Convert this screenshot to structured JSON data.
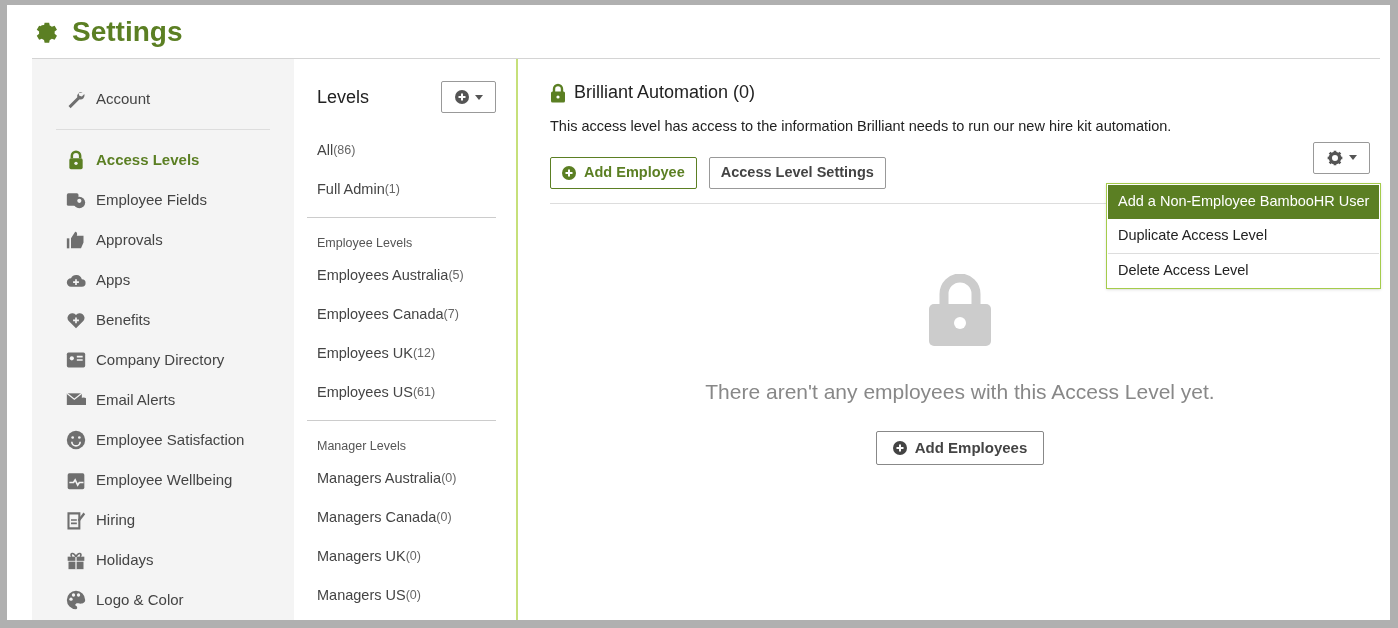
{
  "page_title": "Settings",
  "sidebar": {
    "items": [
      {
        "label": "Account",
        "selected": false
      },
      {
        "label": "Access Levels",
        "selected": true
      },
      {
        "label": "Employee Fields",
        "selected": false
      },
      {
        "label": "Approvals",
        "selected": false
      },
      {
        "label": "Apps",
        "selected": false
      },
      {
        "label": "Benefits",
        "selected": false
      },
      {
        "label": "Company Directory",
        "selected": false
      },
      {
        "label": "Email Alerts",
        "selected": false
      },
      {
        "label": "Employee Satisfaction",
        "selected": false
      },
      {
        "label": "Employee Wellbeing",
        "selected": false
      },
      {
        "label": "Hiring",
        "selected": false
      },
      {
        "label": "Holidays",
        "selected": false
      },
      {
        "label": "Logo & Color",
        "selected": false
      }
    ]
  },
  "levels": {
    "title": "Levels",
    "groups": [
      {
        "items": [
          {
            "name": "All",
            "count": "(86)"
          },
          {
            "name": "Full Admin",
            "count": "(1)"
          }
        ]
      },
      {
        "heading": "Employee Levels",
        "items": [
          {
            "name": "Employees Australia",
            "count": "(5)"
          },
          {
            "name": "Employees Canada",
            "count": "(7)"
          },
          {
            "name": "Employees UK",
            "count": "(12)"
          },
          {
            "name": "Employees US",
            "count": "(61)"
          }
        ]
      },
      {
        "heading": "Manager Levels",
        "items": [
          {
            "name": "Managers Australia",
            "count": "(0)"
          },
          {
            "name": "Managers Canada",
            "count": "(0)"
          },
          {
            "name": "Managers UK",
            "count": "(0)"
          },
          {
            "name": "Managers US",
            "count": "(0)"
          }
        ]
      }
    ]
  },
  "detail": {
    "title": "Brilliant Automation (0)",
    "description": "This access level has access to the information Brilliant needs to run our new hire kit automation.",
    "buttons": [
      {
        "label": "Add Employee",
        "kind": "primary"
      },
      {
        "label": "Access Level Settings",
        "kind": "secondary"
      }
    ],
    "menu": {
      "items": [
        {
          "label": "Add a Non-Employee BambooHR User",
          "selected": true
        },
        {
          "label": "Duplicate Access Level",
          "selected": false
        },
        {
          "label": "Delete Access Level",
          "selected": false
        }
      ]
    },
    "empty_message": "There aren't any employees with this Access Level yet.",
    "empty_button": "Add Employees"
  }
}
